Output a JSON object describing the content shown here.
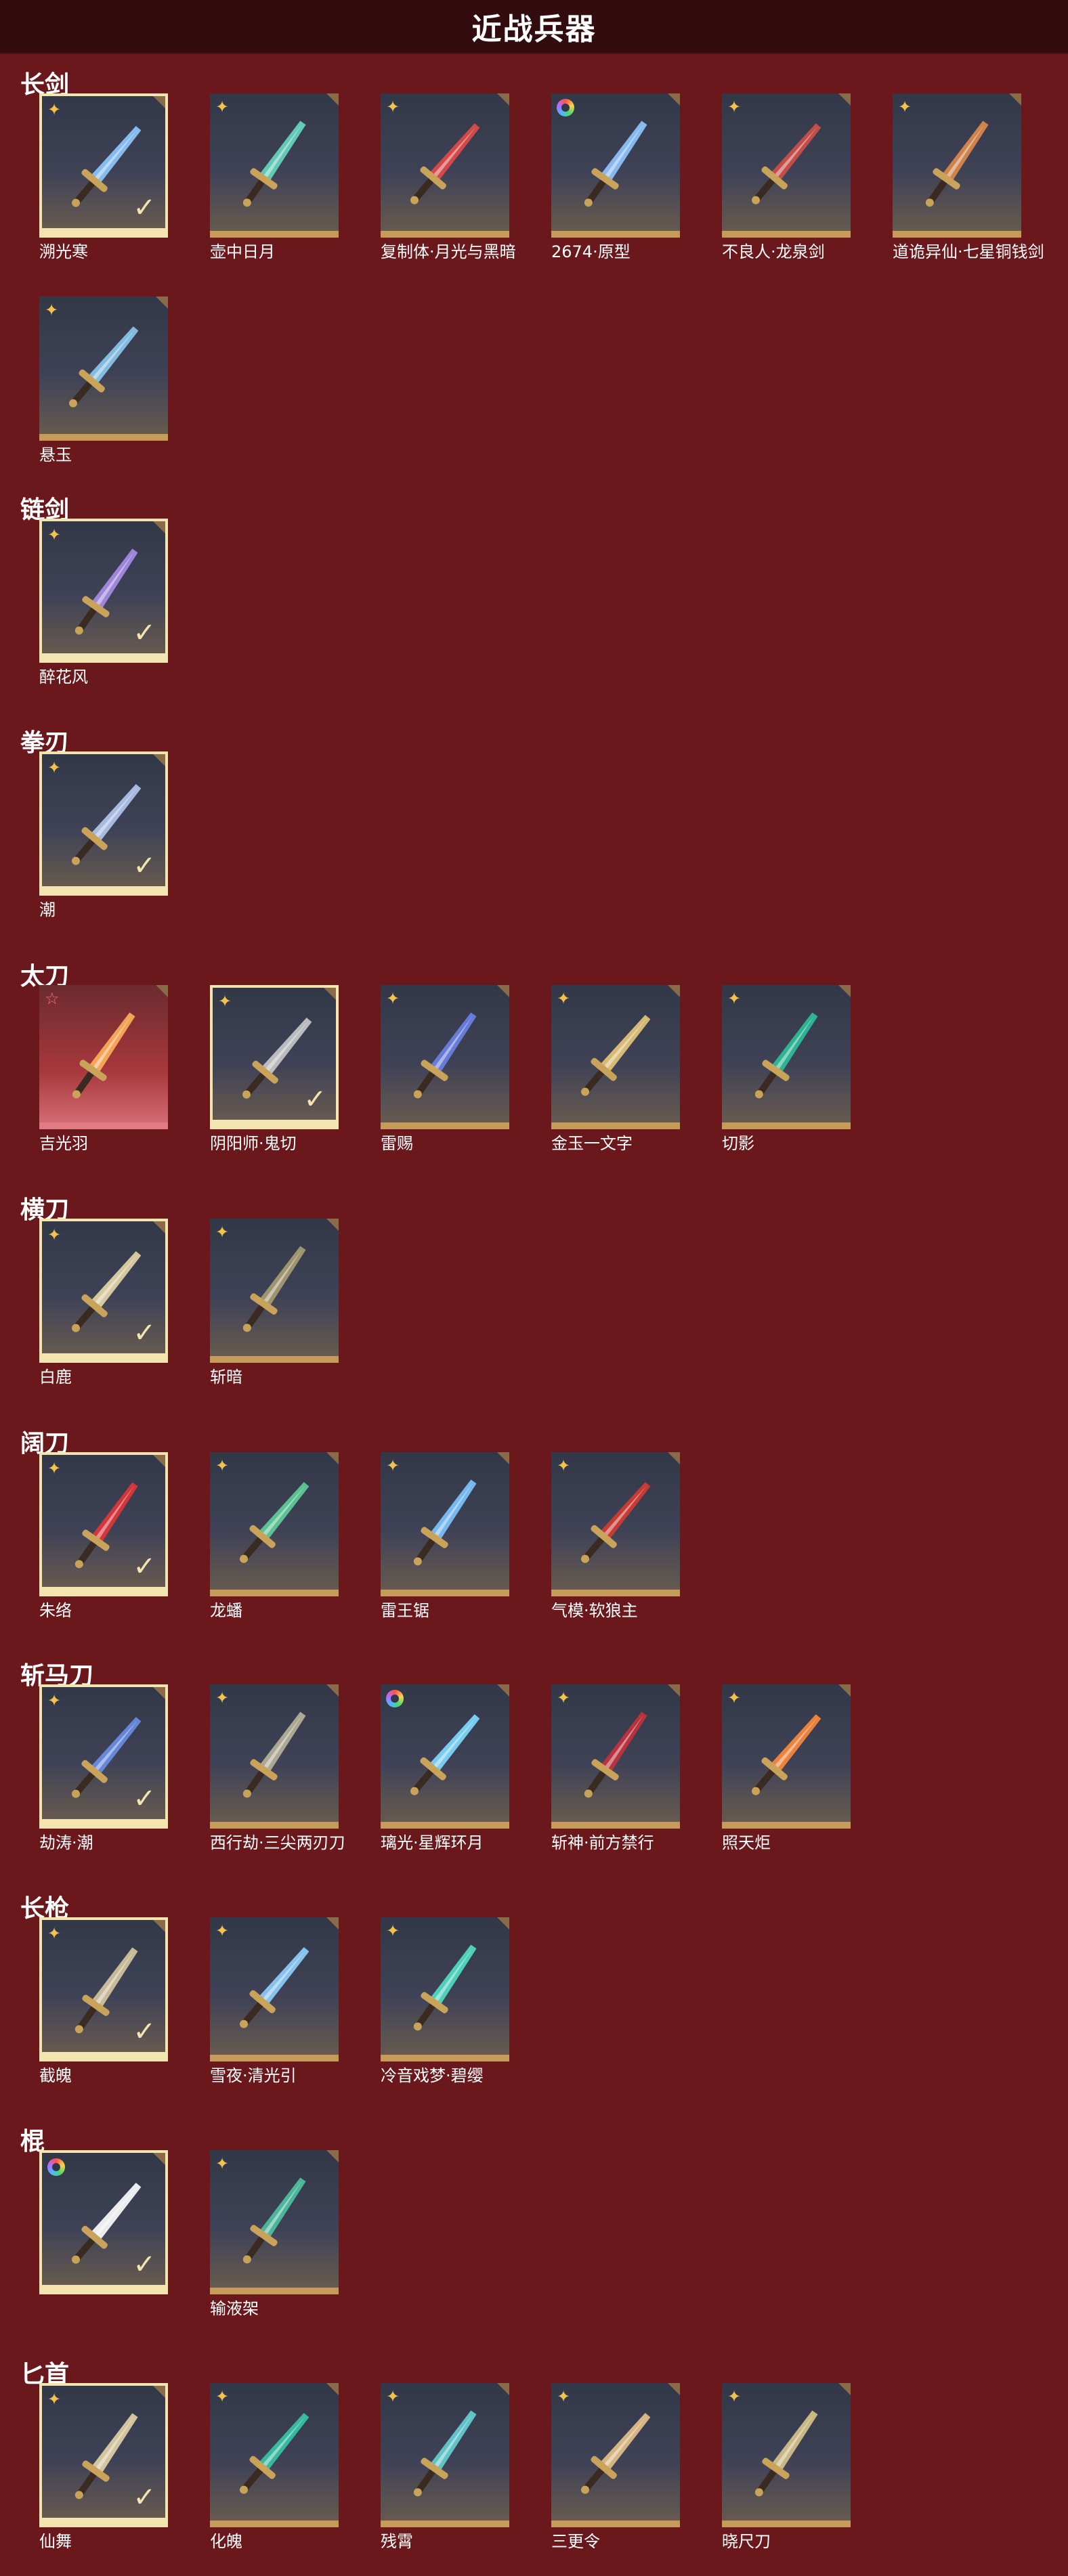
{
  "title": "近战兵器",
  "sections": [
    {
      "name": "长剑",
      "items": [
        {
          "label": "溯光寒",
          "badge": "star",
          "owned": true,
          "color": "#8ec9ff"
        },
        {
          "label": "壶中日月",
          "badge": "star",
          "owned": false,
          "color": "#67d8c2"
        },
        {
          "label": "复制体·月光与黑暗",
          "badge": "star",
          "owned": false,
          "color": "#e34a48"
        },
        {
          "label": "2674·原型",
          "badge": "ring",
          "owned": false,
          "color": "#8fc6ff"
        },
        {
          "label": "不良人·龙泉剑",
          "badge": "star",
          "owned": false,
          "color": "#d24f48"
        },
        {
          "label": "道诡异仙·七星铜钱剑",
          "badge": "star",
          "owned": false,
          "color": "#e08a4a"
        },
        {
          "label": "悬玉",
          "badge": "star",
          "owned": false,
          "color": "#8cc9f0"
        }
      ]
    },
    {
      "name": "链剑",
      "items": [
        {
          "label": "醉花风",
          "badge": "star",
          "owned": true,
          "color": "#a98ee8"
        }
      ]
    },
    {
      "name": "拳刃",
      "items": [
        {
          "label": "潮",
          "badge": "star",
          "owned": true,
          "color": "#b2c8ef"
        }
      ]
    },
    {
      "name": "太刀",
      "items": [
        {
          "label": "吉光羽",
          "badge": "outline-star",
          "owned": false,
          "red": true,
          "color": "#ffb05a"
        },
        {
          "label": "阴阳师·鬼切",
          "badge": "star",
          "owned": true,
          "color": "#c9c9c9"
        },
        {
          "label": "雷赐",
          "badge": "star",
          "owned": false,
          "color": "#6d82e5"
        },
        {
          "label": "金玉一文字",
          "badge": "star",
          "owned": false,
          "color": "#e7c87a"
        },
        {
          "label": "切影",
          "badge": "star",
          "owned": false,
          "color": "#2cc09a"
        }
      ]
    },
    {
      "name": "横刀",
      "items": [
        {
          "label": "白鹿",
          "badge": "star",
          "owned": true,
          "color": "#e6d8a6"
        },
        {
          "label": "斩暗",
          "badge": "star",
          "owned": false,
          "color": "#a89e72"
        }
      ]
    },
    {
      "name": "阔刀",
      "items": [
        {
          "label": "朱络",
          "badge": "star",
          "owned": true,
          "color": "#e33538"
        },
        {
          "label": "龙蟠",
          "badge": "star",
          "owned": false,
          "color": "#5fcf9a"
        },
        {
          "label": "雷王锯",
          "badge": "star",
          "owned": false,
          "color": "#7dc7ff"
        },
        {
          "label": "气模·软狼主",
          "badge": "star",
          "owned": false,
          "color": "#d63b32"
        }
      ]
    },
    {
      "name": "斩马刀",
      "items": [
        {
          "label": "劫涛·潮",
          "badge": "star",
          "owned": true,
          "color": "#6b8fe8"
        },
        {
          "label": "西行劫·三尖两刃刀",
          "badge": "star",
          "owned": false,
          "color": "#b9b49b"
        },
        {
          "label": "璃光·星辉环月",
          "badge": "ring",
          "owned": false,
          "color": "#7fdcff"
        },
        {
          "label": "斩神·前方禁行",
          "badge": "star",
          "owned": false,
          "color": "#c7313b"
        },
        {
          "label": "照天炬",
          "badge": "star",
          "owned": false,
          "color": "#ff8a3a"
        }
      ]
    },
    {
      "name": "长枪",
      "items": [
        {
          "label": "截魄",
          "badge": "star",
          "owned": true,
          "color": "#d7c8a0"
        },
        {
          "label": "雪夜·清光引",
          "badge": "star",
          "owned": false,
          "color": "#8fd0ff"
        },
        {
          "label": "冷音戏梦·碧缨",
          "badge": "star",
          "owned": false,
          "color": "#52e0c6"
        }
      ]
    },
    {
      "name": "棍",
      "items": [
        {
          "label": "",
          "badge": "ring",
          "owned": true,
          "color": "#ffffff"
        },
        {
          "label": "输液架",
          "badge": "star",
          "owned": false,
          "color": "#4fc3a2"
        }
      ]
    },
    {
      "name": "匕首",
      "items": [
        {
          "label": "仙舞",
          "badge": "star",
          "owned": true,
          "color": "#e3d4a6"
        },
        {
          "label": "化魄",
          "badge": "star",
          "owned": false,
          "color": "#36c8a7"
        },
        {
          "label": "残霄",
          "badge": "star",
          "owned": false,
          "color": "#66d1d4"
        },
        {
          "label": "三更令",
          "badge": "star",
          "owned": false,
          "color": "#e7c28a"
        },
        {
          "label": "晓尺刀",
          "badge": "star",
          "owned": false,
          "color": "#d7c58a"
        }
      ]
    }
  ]
}
